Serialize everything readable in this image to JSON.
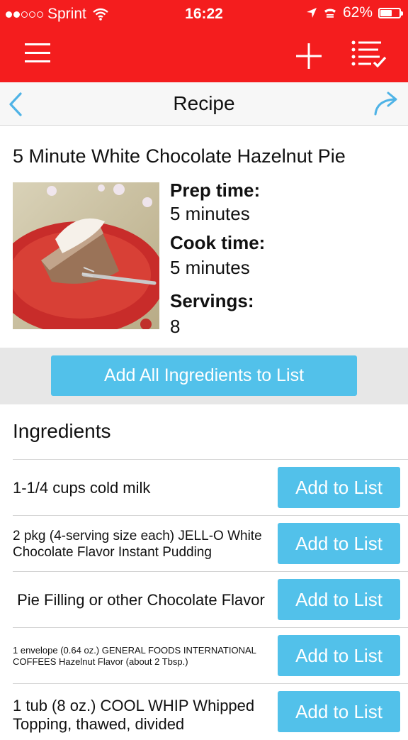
{
  "status_bar": {
    "carrier": "Sprint",
    "time": "16:22",
    "battery_percent": "62%",
    "battery_level": 0.62,
    "icons": [
      "signal-dots",
      "wifi-icon",
      "location-arrow-icon",
      "tty-icon",
      "battery-icon"
    ]
  },
  "toolbar": {
    "color": "#f41d1e",
    "icons": [
      "hamburger-menu-icon",
      "add-icon",
      "checklist-icon"
    ]
  },
  "navbar": {
    "title": "Recipe",
    "back_icon": "chevron-left-icon",
    "share_icon": "share-arrow-icon",
    "accent": "#4fb3e6"
  },
  "recipe": {
    "title": "5 Minute White Chocolate Hazelnut Pie",
    "prep_label": "Prep time:",
    "prep_value": "5 minutes",
    "cook_label": "Cook time:",
    "cook_value": "5 minutes",
    "servings_label": "Servings:",
    "servings_value": "8"
  },
  "add_all_button": "Add All Ingredients to List",
  "ingredients": {
    "header": "Ingredients",
    "button_label": "Add to List",
    "button_color": "#52c1ea",
    "items": [
      {
        "text": "1-1/4 cups cold milk"
      },
      {
        "text": "2 pkg (4-serving size each) JELL-O White Chocolate Flavor Instant Pudding"
      },
      {
        "text": " Pie Filling or other Chocolate Flavor"
      },
      {
        "text": "1 envelope (0.64 oz.) GENERAL FOODS INTERNATIONAL COFFEES Hazelnut Flavor (about 2 Tbsp.)"
      },
      {
        "text": "1 tub (8 oz.) COOL WHIP Whipped Topping, thawed, divided"
      }
    ]
  }
}
